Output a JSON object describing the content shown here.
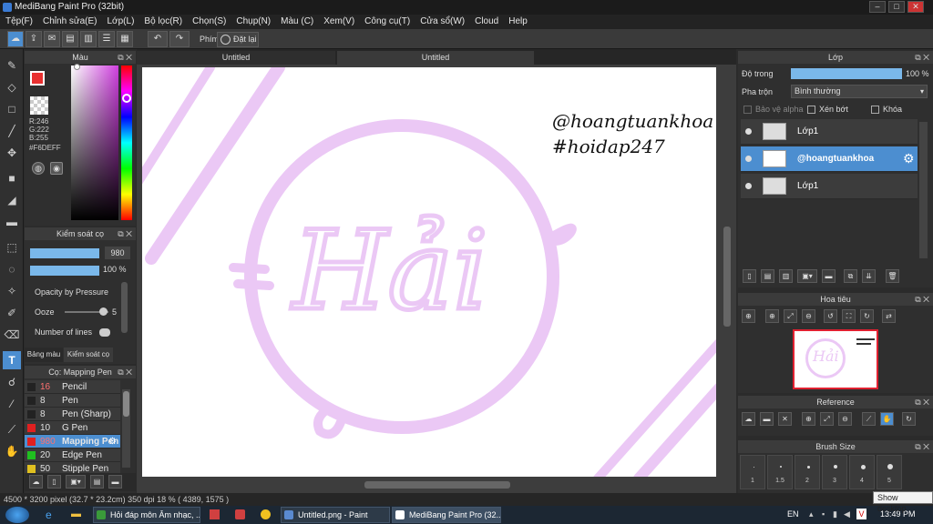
{
  "window": {
    "title": "MediBang Paint Pro (32bit)",
    "controls": [
      "–",
      "□",
      "✕"
    ]
  },
  "menu": [
    "Tệp(F)",
    "Chỉnh sửa(E)",
    "Lớp(L)",
    "Bộ lọc(R)",
    "Chọn(S)",
    "Chụp(N)",
    "Màu (C)",
    "Xem(V)",
    "Công cụ(T)",
    "Cửa sổ(W)",
    "Cloud",
    "Help"
  ],
  "toolbar": {
    "phim_label": "Phím",
    "reset_label": "Đặt lại"
  },
  "color_panel": {
    "title": "Màu",
    "r": "R:246",
    "g": "G:222",
    "b": "B:255",
    "hex": "#F6DEFF",
    "primary_color": "#F6DEFF",
    "accent_color": "#E83030"
  },
  "brush_control": {
    "title": "Kiểm soát cọ",
    "size_value": "980",
    "opacity_value": "100 %",
    "opacity_pressure_label": "Opacity by Pressure",
    "ooze_label": "Ooze",
    "ooze_value": "5",
    "lines_label": "Number of lines",
    "tab_palette": "Bảng màu",
    "tab_brush": "Kiểm soát cọ"
  },
  "brush_list": {
    "title": "Cọ: Mapping Pen",
    "items": [
      {
        "size": "16",
        "name": "Pencil",
        "color": "#222222",
        "size_color": "#ff7070"
      },
      {
        "size": "8",
        "name": "Pen",
        "color": "#222222",
        "size_color": "#e0e0e0"
      },
      {
        "size": "8",
        "name": "Pen (Sharp)",
        "color": "#222222",
        "size_color": "#e0e0e0"
      },
      {
        "size": "10",
        "name": "G Pen",
        "color": "#e02020",
        "size_color": "#e0e0e0"
      },
      {
        "size": "980",
        "name": "Mapping Pen",
        "color": "#e02020",
        "size_color": "#ff7070"
      },
      {
        "size": "20",
        "name": "Edge Pen",
        "color": "#20c020",
        "size_color": "#e0e0e0"
      },
      {
        "size": "50",
        "name": "Stipple Pen",
        "color": "#e0c020",
        "size_color": "#e0e0e0"
      }
    ]
  },
  "tabs": [
    "Untitled",
    "Untitled"
  ],
  "canvas": {
    "main_text": "Hải",
    "handle_line1": "@hoangtuankhoa",
    "handle_line2": "#hoidap247",
    "stroke_color": "#EBC8F5"
  },
  "layer_panel": {
    "title": "Lớp",
    "opacity_label": "Độ trong",
    "opacity_value": "100 %",
    "blend_label": "Pha trộn",
    "blend_value": "Bình thường",
    "protect_alpha": "Bảo vệ alpha",
    "clip": "Xén bớt",
    "lock": "Khóa",
    "layers": [
      "Lớp1",
      "@hoangtuankhoa",
      "Lớp1"
    ]
  },
  "navigator": {
    "title": "Hoa tiêu",
    "thumb_text": "Hải"
  },
  "reference": {
    "title": "Reference"
  },
  "brush_size": {
    "title": "Brush Size",
    "sizes": [
      "1",
      "1.5",
      "2",
      "3",
      "4",
      "5"
    ]
  },
  "status": {
    "text": "4500 * 3200 pixel  (32.7 * 23.2cm)  350 dpi  18 %  ( 4389, 1575 )"
  },
  "taskbar": {
    "items": [
      "Hỏi đáp môn Âm nhạc, ...",
      "Untitled.png - Paint",
      "MediBang Paint Pro (32..."
    ],
    "lang": "EN",
    "time": "13:49 PM",
    "tooltip": "Show desktop"
  }
}
